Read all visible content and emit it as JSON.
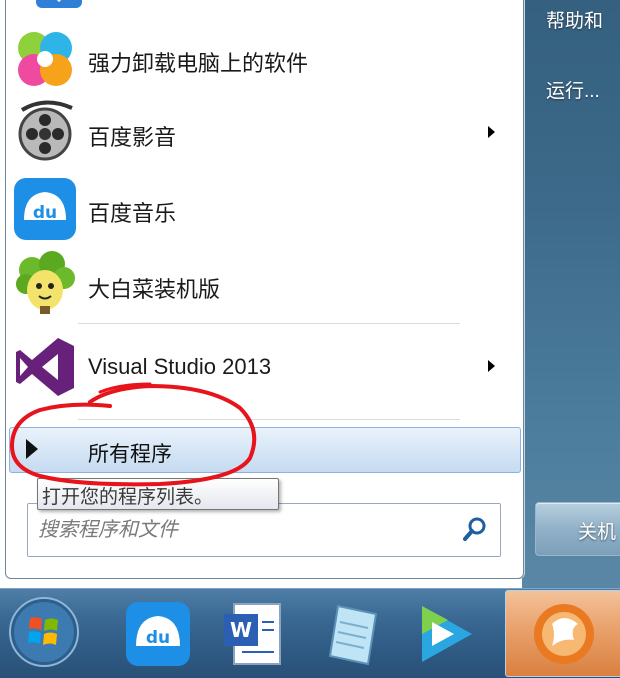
{
  "right_pane": {
    "items": [
      "帮助和",
      "运行..."
    ],
    "shutdown_label": "关机"
  },
  "programs": [
    {
      "label": "强力卸载电脑上的软件",
      "icon": "pinwheel-icon",
      "has_submenu": false
    },
    {
      "label": "百度影音",
      "icon": "film-reel-icon",
      "has_submenu": true
    },
    {
      "label": "百度音乐",
      "icon": "baidu-music-icon",
      "has_submenu": false
    },
    {
      "label": "大白菜装机版",
      "icon": "cabbage-icon",
      "has_submenu": false
    },
    {
      "label": "Visual Studio 2013",
      "icon": "visual-studio-icon",
      "has_submenu": true
    }
  ],
  "all_programs_label": "所有程序",
  "tooltip": "打开您的程序列表。",
  "search": {
    "placeholder": "搜索程序和文件"
  },
  "taskbar": {
    "items": [
      "start-orb-icon",
      "baidu-music-icon",
      "word-icon",
      "notepad-icon",
      "video-play-icon",
      "browser-icon"
    ]
  },
  "colors": {
    "annotation": "#e8141c",
    "highlight": "#c6dbf1"
  }
}
